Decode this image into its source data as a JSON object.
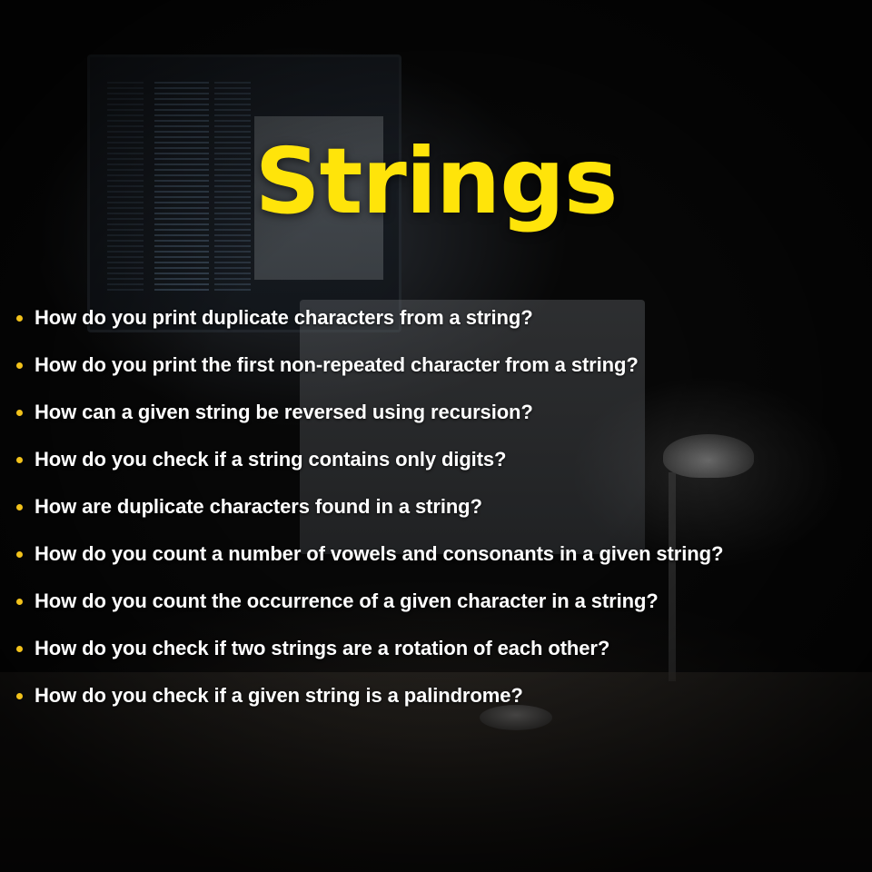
{
  "title": "Strings",
  "accent_color": "#ffe40a",
  "bullet_color": "#f2c21b",
  "questions": [
    "How do you print duplicate characters from a string?",
    "How do you print the first non-repeated character from a string?",
    "How can a given string be reversed using recursion?",
    "How do you check if a string contains only digits?",
    "How are duplicate characters found in a string?",
    "How do you count a number of vowels and consonants in a given string?",
    "How do you count the occurrence of a given character in a string?",
    "How do you check if two strings are a rotation of each other?",
    "How do you check if a given string is a palindrome?"
  ]
}
